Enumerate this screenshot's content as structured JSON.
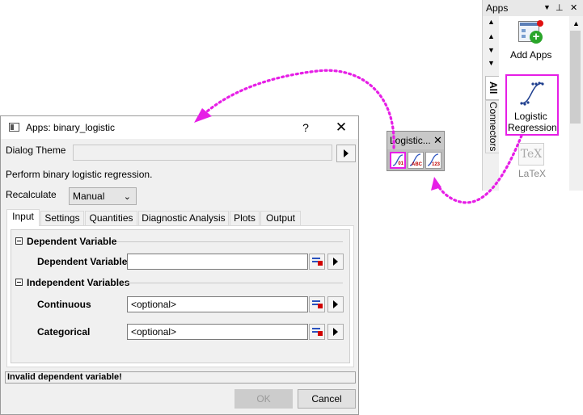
{
  "dialog": {
    "title": "Apps: binary_logistic",
    "help": "?",
    "close": "✕",
    "theme_label": "Dialog Theme",
    "theme_value": "",
    "description": "Perform binary logistic regression.",
    "recalc_label": "Recalculate",
    "recalc_value": "Manual",
    "tabs": [
      {
        "label": "Input",
        "active": true
      },
      {
        "label": "Settings"
      },
      {
        "label": "Quantities"
      },
      {
        "label": "Diagnostic Analysis"
      },
      {
        "label": "Plots"
      },
      {
        "label": "Output"
      }
    ],
    "sections": {
      "dependent": {
        "title": "Dependent Variable",
        "field_label": "Dependent Variable",
        "value": ""
      },
      "independent": {
        "title": "Independent Variables",
        "continuous_label": "Continuous",
        "continuous_value": "<optional>",
        "categorical_label": "Categorical",
        "categorical_value": "<optional>"
      }
    },
    "status": "Invalid dependent variable!",
    "ok": "OK",
    "cancel": "Cancel"
  },
  "mini_toolbar": {
    "title": "Logistic...",
    "close": "✕",
    "buttons": [
      {
        "caption": "01"
      },
      {
        "caption": "ABC"
      },
      {
        "caption": "123"
      }
    ]
  },
  "apps_pane": {
    "title": "Apps",
    "tabs": [
      "All",
      "Connectors"
    ],
    "add_apps": "Add Apps",
    "logistic_line1": "Logistic",
    "logistic_line2": "Regression",
    "latex": "LaTeX",
    "latex_logo": "TeX"
  },
  "colors": {
    "highlight": "#e61ee6",
    "dialog_bg": "#f0f0f0"
  }
}
